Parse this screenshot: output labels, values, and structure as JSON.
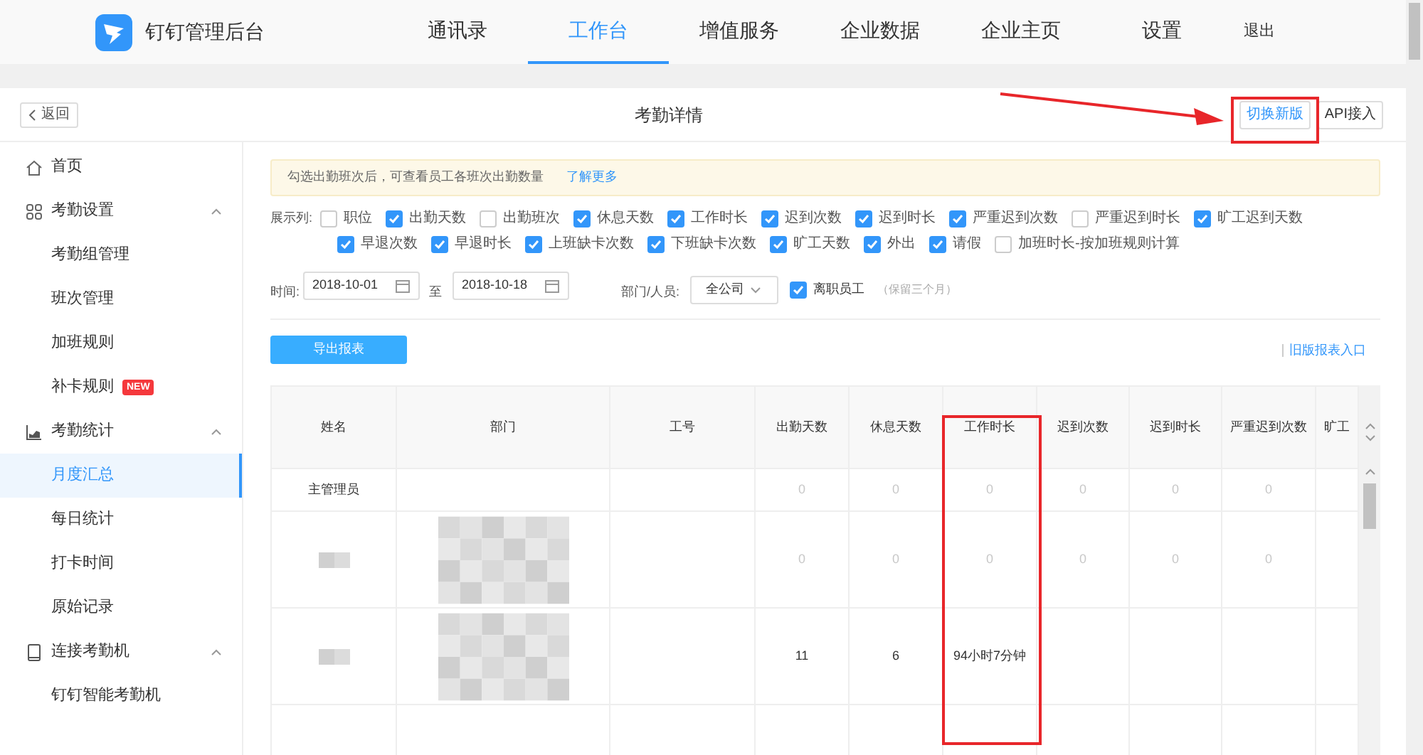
{
  "nav": {
    "brand": "钉钉管理后台",
    "items": [
      {
        "label": "通讯录",
        "selected": false
      },
      {
        "label": "工作台",
        "selected": true
      },
      {
        "label": "增值服务",
        "selected": false
      },
      {
        "label": "企业数据",
        "selected": false
      },
      {
        "label": "企业主页",
        "selected": false
      },
      {
        "label": "设置",
        "selected": false
      }
    ],
    "logout": "退出"
  },
  "header": {
    "back": "返回",
    "title": "考勤详情",
    "switch": "切换新版",
    "api": "API接入"
  },
  "sidebar": [
    {
      "label": "首页",
      "kind": "home"
    },
    {
      "label": "考勤设置",
      "kind": "settings",
      "expanded": true,
      "children": [
        {
          "label": "考勤组管理",
          "selected": false
        },
        {
          "label": "班次管理",
          "selected": false
        },
        {
          "label": "加班规则",
          "selected": false
        },
        {
          "label": "补卡规则",
          "selected": false,
          "badge": "NEW"
        }
      ]
    },
    {
      "label": "考勤统计",
      "kind": "chart",
      "expanded": true,
      "children": [
        {
          "label": "月度汇总",
          "selected": true
        },
        {
          "label": "每日统计",
          "selected": false
        },
        {
          "label": "打卡时间",
          "selected": false
        },
        {
          "label": "原始记录",
          "selected": false
        }
      ]
    },
    {
      "label": "连接考勤机",
      "kind": "device",
      "expanded": true,
      "children": [
        {
          "label": "钉钉智能考勤机",
          "selected": false
        }
      ]
    }
  ],
  "notice": {
    "text": "勾选出勤班次后，可查看员工各班次出勤数量",
    "link": "了解更多"
  },
  "columns_label": "展示列:",
  "column_options": [
    {
      "label": "职位",
      "checked": false
    },
    {
      "label": "出勤天数",
      "checked": true
    },
    {
      "label": "出勤班次",
      "checked": false
    },
    {
      "label": "休息天数",
      "checked": true
    },
    {
      "label": "工作时长",
      "checked": true
    },
    {
      "label": "迟到次数",
      "checked": true
    },
    {
      "label": "迟到时长",
      "checked": true
    },
    {
      "label": "严重迟到次数",
      "checked": true
    },
    {
      "label": "严重迟到时长",
      "checked": false
    },
    {
      "label": "旷工迟到天数",
      "checked": true
    },
    {
      "label": "早退次数",
      "checked": true
    },
    {
      "label": "早退时长",
      "checked": true
    },
    {
      "label": "上班缺卡次数",
      "checked": true
    },
    {
      "label": "下班缺卡次数",
      "checked": true
    },
    {
      "label": "旷工天数",
      "checked": true
    },
    {
      "label": "外出",
      "checked": true
    },
    {
      "label": "请假",
      "checked": true
    },
    {
      "label": "加班时长-按加班规则计算",
      "checked": false
    }
  ],
  "filters": {
    "time_label": "时间:",
    "start": "2018-10-01",
    "to": "至",
    "end": "2018-10-18",
    "dept_label": "部门/人员:",
    "dept": "全公司",
    "resigned": {
      "label": "离职员工",
      "checked": true,
      "hint": "（保留三个月）"
    }
  },
  "export_button": "导出报表",
  "old_link": "旧版报表入口",
  "table": {
    "columns": [
      "姓名",
      "部门",
      "工号",
      "出勤天数",
      "休息天数",
      "工作时长",
      "迟到次数",
      "迟到时长",
      "严重迟到次数",
      "旷工"
    ],
    "rows": [
      {
        "cells": [
          {
            "kind": "text",
            "text": "主管理员"
          },
          {
            "kind": "blank"
          },
          {
            "kind": "blank"
          },
          {
            "kind": "muted",
            "text": "0"
          },
          {
            "kind": "muted",
            "text": "0"
          },
          {
            "kind": "muted",
            "text": "0"
          },
          {
            "kind": "muted",
            "text": "0"
          },
          {
            "kind": "muted",
            "text": "0"
          },
          {
            "kind": "muted",
            "text": "0"
          },
          {
            "kind": "blank"
          }
        ]
      },
      {
        "cells": [
          {
            "kind": "blurred"
          },
          {
            "kind": "blurred"
          },
          {
            "kind": "blank"
          },
          {
            "kind": "muted",
            "text": "0"
          },
          {
            "kind": "muted",
            "text": "0"
          },
          {
            "kind": "muted",
            "text": "0"
          },
          {
            "kind": "muted",
            "text": "0"
          },
          {
            "kind": "muted",
            "text": "0"
          },
          {
            "kind": "muted",
            "text": "0"
          },
          {
            "kind": "blank"
          }
        ]
      },
      {
        "cells": [
          {
            "kind": "blurred"
          },
          {
            "kind": "blurred"
          },
          {
            "kind": "blank"
          },
          {
            "kind": "text",
            "text": "11"
          },
          {
            "kind": "text",
            "text": "6"
          },
          {
            "kind": "text",
            "text": "94小时7分钟"
          },
          {
            "kind": "blank"
          },
          {
            "kind": "blank"
          },
          {
            "kind": "blank"
          },
          {
            "kind": "blank"
          }
        ]
      },
      {
        "cells": [
          {
            "kind": "blank"
          },
          {
            "kind": "blank"
          },
          {
            "kind": "blank"
          },
          {
            "kind": "blank"
          },
          {
            "kind": "blank"
          },
          {
            "kind": "blank"
          },
          {
            "kind": "blank"
          },
          {
            "kind": "blank"
          },
          {
            "kind": "blank"
          },
          {
            "kind": "blank"
          }
        ]
      }
    ]
  },
  "annotations": {
    "highlight_switch": true,
    "highlight_work_hours_column": true
  }
}
